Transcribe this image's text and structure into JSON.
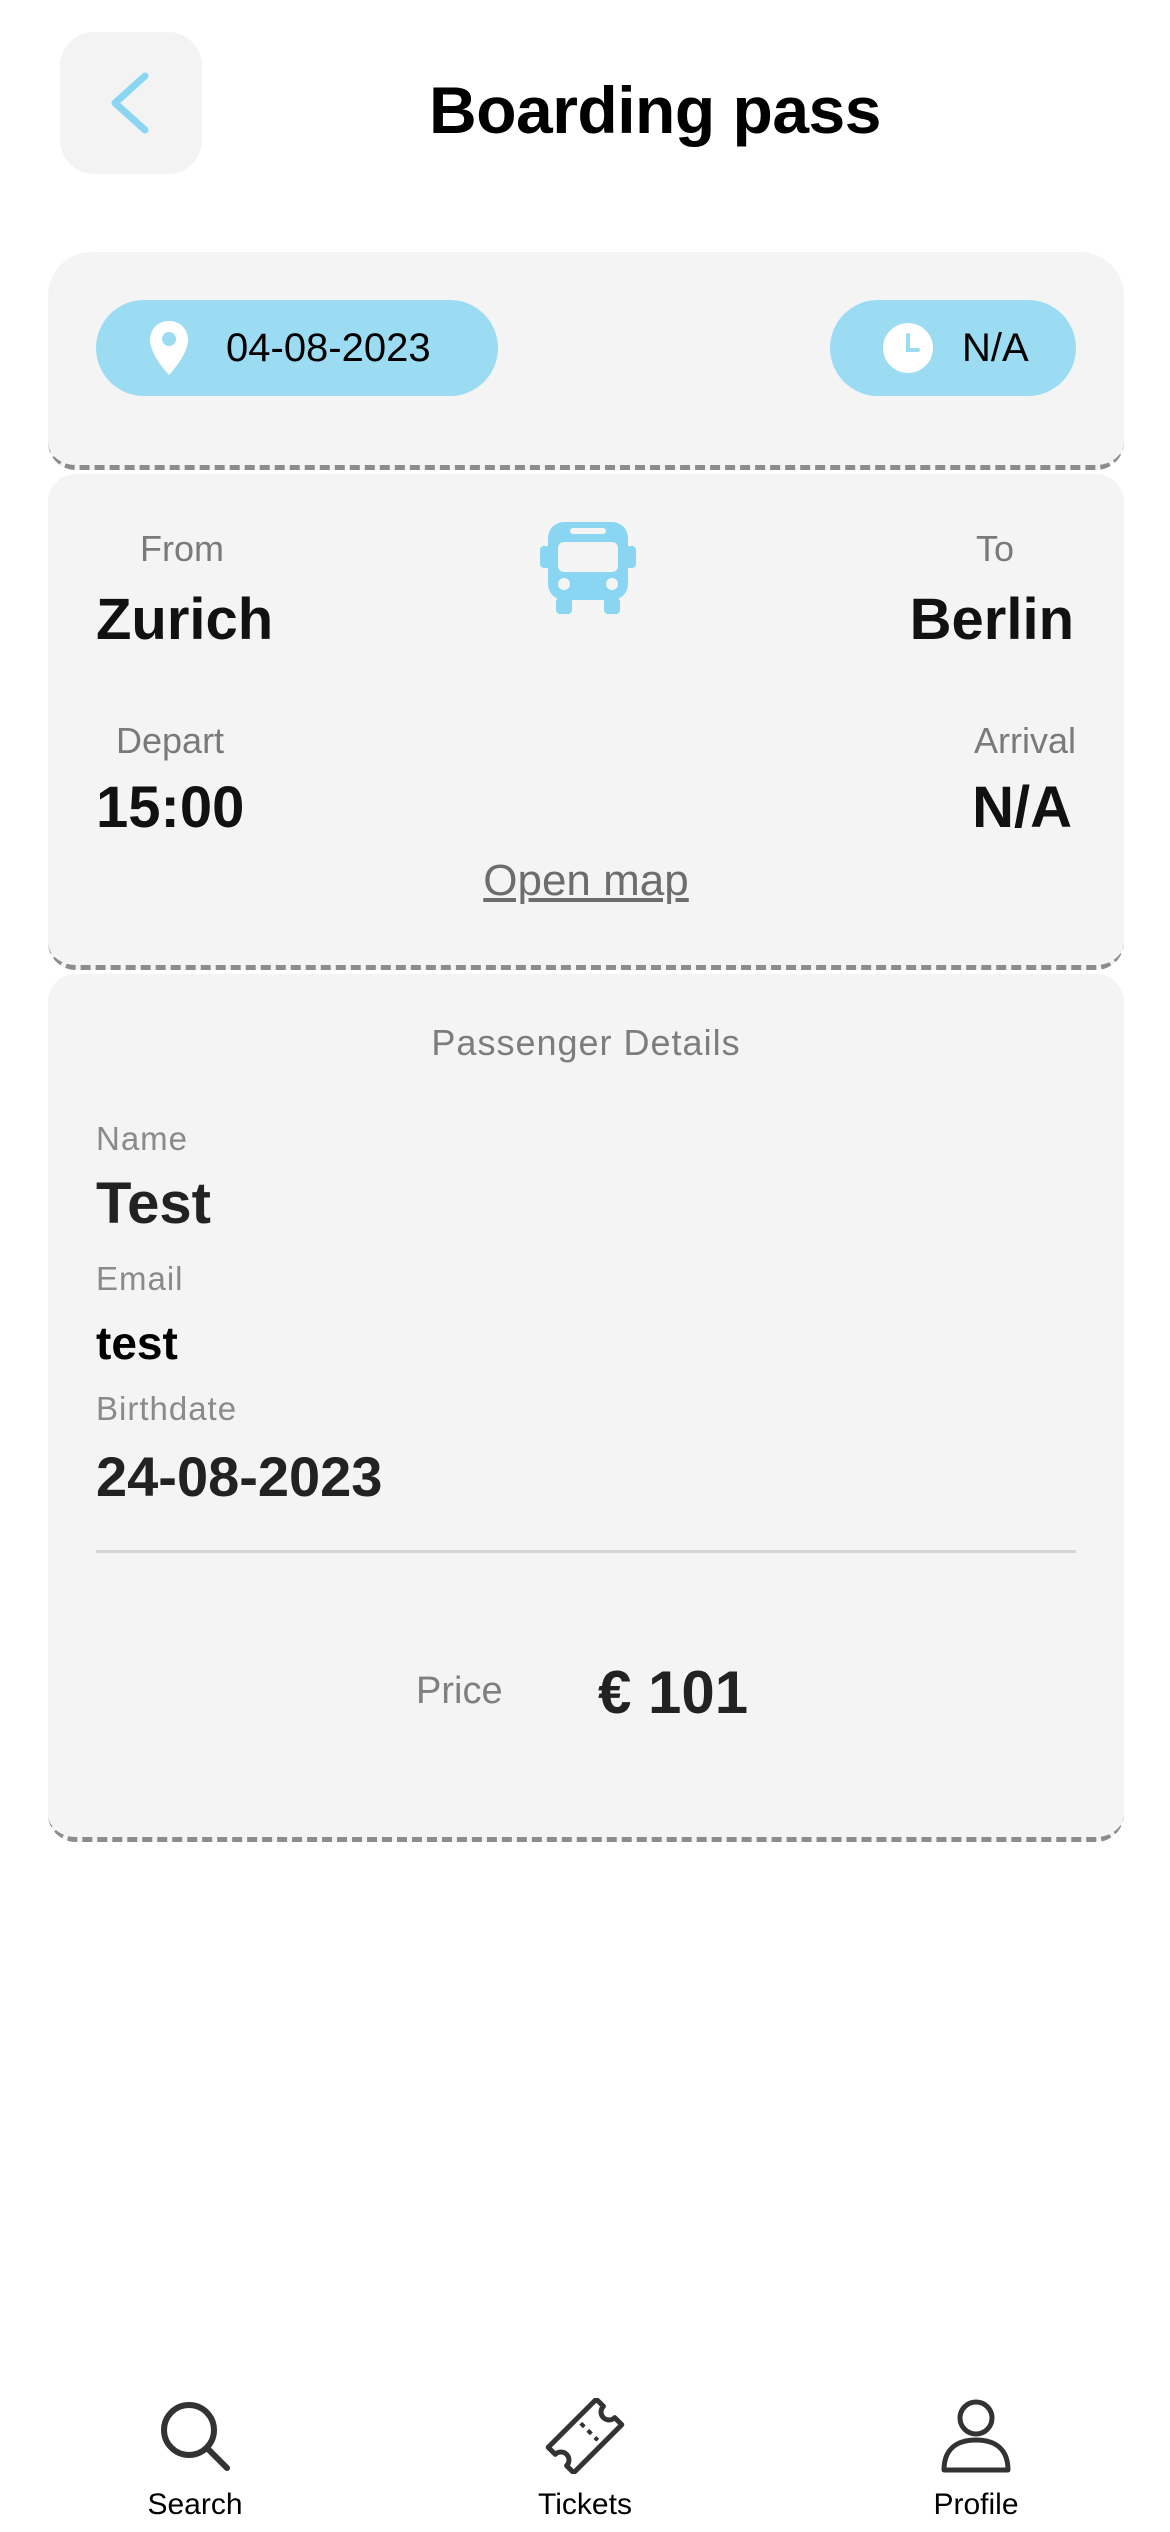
{
  "header": {
    "title": "Boarding pass"
  },
  "trip": {
    "date": "04-08-2023",
    "time": "N/A",
    "from_label": "From",
    "from_city": "Zurich",
    "to_label": "To",
    "to_city": "Berlin",
    "depart_label": "Depart",
    "depart_time": "15:00",
    "arrival_label": "Arrival",
    "arrival_time": "N/A",
    "open_map_label": "Open map"
  },
  "passenger": {
    "section_title": "Passenger Details",
    "name_label": "Name",
    "name": "Test",
    "email_label": "Email",
    "email": "test",
    "birthdate_label": "Birthdate",
    "birthdate": "24-08-2023",
    "price_label": "Price",
    "price": "€ 101"
  },
  "nav": {
    "items": [
      {
        "label": "Search",
        "icon": "search-icon"
      },
      {
        "label": "Tickets",
        "icon": "ticket-icon"
      },
      {
        "label": "Profile",
        "icon": "person-icon"
      }
    ]
  },
  "colors": {
    "accent": "#9bdcf3",
    "icon_blue": "#8ad6f2",
    "card_bg": "#f4f4f4"
  }
}
